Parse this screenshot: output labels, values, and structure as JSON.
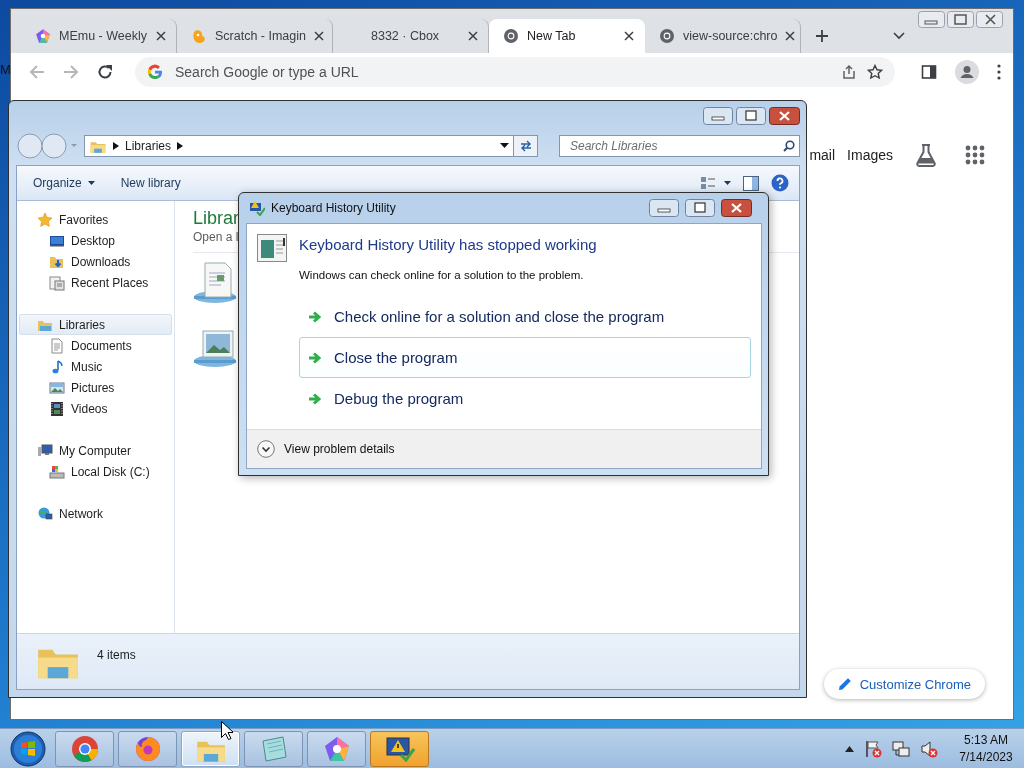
{
  "desktop": {
    "edge_label": "M"
  },
  "browser": {
    "tabs": [
      {
        "title": "MEmu - Weekly",
        "kind": "memu",
        "selected": false
      },
      {
        "title": "Scratch - Imagin",
        "kind": "scratch",
        "selected": false
      },
      {
        "title": "8332 · Cbox",
        "kind": "blank",
        "selected": false
      },
      {
        "title": "New Tab",
        "kind": "chrome",
        "selected": true
      },
      {
        "title": "view-source:chro",
        "kind": "chrome",
        "selected": false
      }
    ],
    "address": {
      "placeholder": "Search Google or type a URL"
    },
    "top_links": [
      "mail",
      "Images"
    ],
    "customize_button": "Customize Chrome"
  },
  "explorer": {
    "breadcrumb": "Libraries",
    "search": {
      "placeholder": "Search Libraries"
    },
    "commands": [
      {
        "label": "Organize",
        "kind": "menu"
      },
      {
        "label": "New library",
        "kind": "plain"
      }
    ],
    "nav": [
      {
        "label": "Favorites",
        "kind": "favorites",
        "selected": false,
        "children": [
          {
            "label": "Desktop",
            "kind": "desktop",
            "selected": false
          },
          {
            "label": "Downloads",
            "kind": "downloads",
            "selected": false
          },
          {
            "label": "Recent Places",
            "kind": "recent",
            "selected": false
          }
        ]
      },
      {
        "label": "Libraries",
        "kind": "libraries",
        "selected": true,
        "children": [
          {
            "label": "Documents",
            "kind": "documents",
            "selected": false
          },
          {
            "label": "Music",
            "kind": "music",
            "selected": false
          },
          {
            "label": "Pictures",
            "kind": "pictures",
            "selected": false
          },
          {
            "label": "Videos",
            "kind": "videos",
            "selected": false
          }
        ]
      },
      {
        "label": "My Computer",
        "kind": "computer",
        "selected": false,
        "children": [
          {
            "label": "Local Disk (C:)",
            "kind": "disk",
            "selected": false
          }
        ]
      },
      {
        "label": "Network",
        "kind": "network",
        "selected": false
      }
    ],
    "content_title": "Librar",
    "content_subtitle": "Open a l",
    "status": "4 items"
  },
  "dialog": {
    "title": "Keyboard History Utility",
    "heading": "Keyboard History Utility has stopped working",
    "description": "Windows can check online for a solution to the problem.",
    "options": [
      {
        "label": "Check online for a solution and close the program",
        "selected": false
      },
      {
        "label": "Close the program",
        "selected": true
      },
      {
        "label": "Debug the program",
        "selected": false
      }
    ],
    "details_toggle": "View problem details",
    "expanded": false
  },
  "taskbar": {
    "apps": [
      {
        "kind": "chrome",
        "selected": false,
        "flashing": false
      },
      {
        "kind": "firefox",
        "selected": false,
        "flashing": false
      },
      {
        "kind": "explorer",
        "selected": true,
        "flashing": false
      },
      {
        "kind": "notepad",
        "selected": false,
        "flashing": false
      },
      {
        "kind": "memu",
        "selected": false,
        "flashing": false
      },
      {
        "kind": "warning",
        "selected": false,
        "flashing": true
      }
    ],
    "time": "5:13 AM",
    "date": "7/14/2023"
  }
}
